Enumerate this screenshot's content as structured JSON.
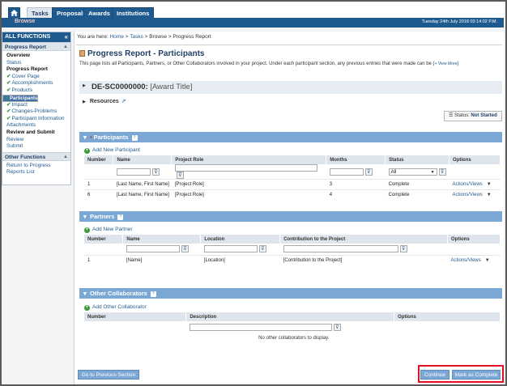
{
  "topnav": {
    "tabs": [
      "Tasks",
      "Proposals",
      "Awards",
      "Institutions"
    ],
    "browse_label": "Browse",
    "datetime": "Tuesday 24th July 2018 03:14:02 P.M."
  },
  "sidebar": {
    "header": "ALL FUNCTIONS",
    "collapse_icon": "«",
    "section1": "Progress Report",
    "items": [
      {
        "label": "Overview",
        "style": "bold"
      },
      {
        "label": "Status",
        "style": "link"
      },
      {
        "label": "Progress Report",
        "style": "bold"
      },
      {
        "label": "Cover Page",
        "style": "check"
      },
      {
        "label": "Accomplishments",
        "style": "check"
      },
      {
        "label": "Products",
        "style": "check"
      },
      {
        "label": "Participants",
        "style": "selected"
      },
      {
        "label": "Impact",
        "style": "check"
      },
      {
        "label": "Changes-Problems",
        "style": "check"
      },
      {
        "label": "Participant Information Attachments",
        "style": "check"
      },
      {
        "label": "Review and Submit",
        "style": "bold"
      },
      {
        "label": "Review",
        "style": "link"
      },
      {
        "label": "Submit",
        "style": "link"
      }
    ],
    "section2": "Other Functions",
    "other_link": "Return to Progress Reports List"
  },
  "breadcrumb": {
    "prefix": "You are here:",
    "items": [
      "Home",
      "Tasks",
      "Browse"
    ],
    "current": "Progress Report"
  },
  "page": {
    "title": "Progress Report - Participants",
    "intro": "This page lists all Participants, Partners, or Other Collaborators involved in your project. Under each participant section, any previous entries that were made can be",
    "view_more": "View More",
    "award_id": "DE-SC0000000:",
    "award_title": "[Award Title]",
    "resources": "Resources",
    "status_label": "Status:",
    "status_value": "Not Started"
  },
  "participants": {
    "title": "Participants",
    "add_link": "Add New Participant",
    "columns": [
      "Number",
      "Name",
      "Project Role",
      "Months",
      "Status",
      "Options"
    ],
    "status_filter": "All",
    "rows": [
      {
        "number": "1",
        "name": "[Last Name, First Name]",
        "role": "[Project Role]",
        "months": "3",
        "status": "Complete",
        "options": "Actions/Views"
      },
      {
        "number": "6",
        "name": "[Last Name, First Name]",
        "role": "[Project Role]",
        "months": "4",
        "status": "Complete",
        "options": "Actions/Views"
      }
    ]
  },
  "partners": {
    "title": "Partners",
    "add_link": "Add New Partner",
    "columns": [
      "Number",
      "Name",
      "Location",
      "Contribution to the Project",
      "Options"
    ],
    "rows": [
      {
        "number": "1",
        "name": "[Name]",
        "location": "[Location]",
        "contribution": "[Contribution to the Project]",
        "options": "Actions/Views"
      }
    ]
  },
  "collaborators": {
    "title": "Other Collaborators",
    "add_link": "Add Other Collaborator",
    "columns": [
      "Number",
      "Description",
      "Options"
    ],
    "empty_message": "No other collaborators to display."
  },
  "footer": {
    "prev_button": "Go to Previous Section",
    "continue_button": "Continue",
    "complete_button": "Mark as Complete"
  }
}
